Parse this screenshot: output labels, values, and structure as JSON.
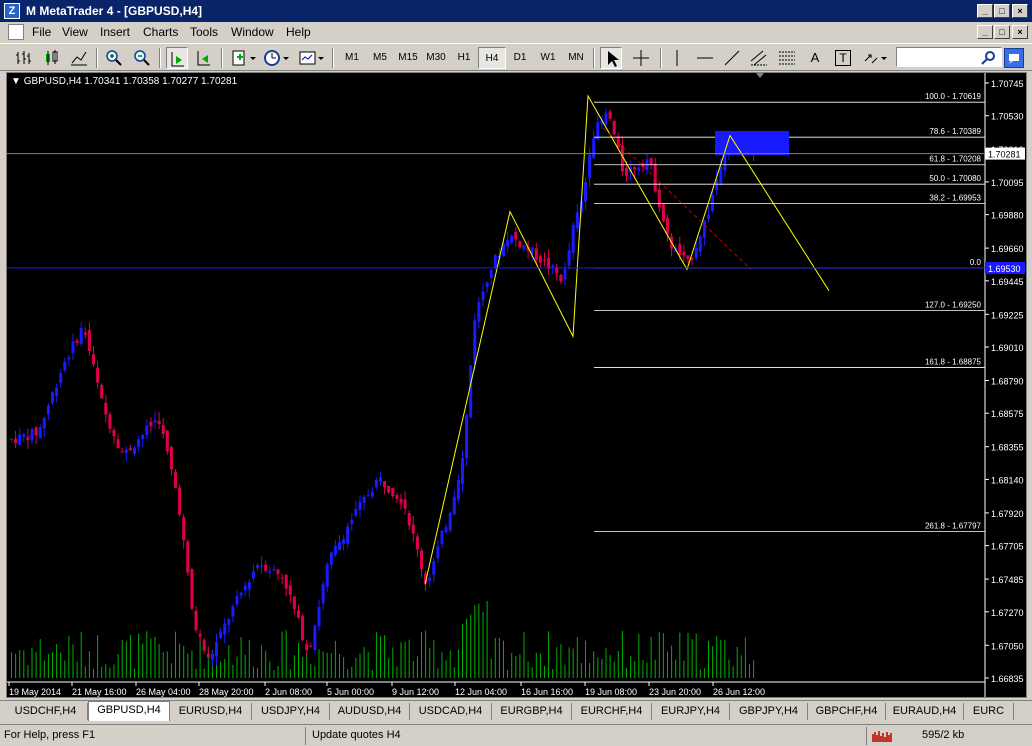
{
  "window": {
    "title": "M MetaTrader 4 - [GBPUSD,H4]",
    "controls": [
      "_",
      "□",
      "×"
    ]
  },
  "menu": [
    "File",
    "View",
    "Insert",
    "Charts",
    "Tools",
    "Window",
    "Help"
  ],
  "toolbar": {
    "timeframes": [
      "M1",
      "M5",
      "M15",
      "M30",
      "H1",
      "H4",
      "D1",
      "W1",
      "MN"
    ],
    "active_timeframe": "H4",
    "tools": [
      "A",
      "T"
    ]
  },
  "chart": {
    "info": "GBPUSD,H4  1.70341 1.70358 1.70277 1.70281",
    "price_labels": [
      "1.70745",
      "1.70530",
      "1.70310",
      "1.70095",
      "1.69880",
      "1.69660",
      "1.69445",
      "1.69225",
      "1.69010",
      "1.68790",
      "1.68575",
      "1.68355",
      "1.68140",
      "1.67920",
      "1.67705",
      "1.67485",
      "1.67270",
      "1.67050",
      "1.66835"
    ],
    "current_price": "1.70281",
    "blue_level": "1.69530",
    "time_labels": [
      "19 May 2014",
      "21 May 16:00",
      "26 May 04:00",
      "28 May 20:00",
      "2 Jun 08:00",
      "5 Jun 00:00",
      "9 Jun 12:00",
      "12 Jun 04:00",
      "16 Jun 16:00",
      "19 Jun 08:00",
      "23 Jun 20:00",
      "26 Jun 12:00"
    ],
    "fib_levels": [
      {
        "label": "100.0 - 1.70619",
        "price": 1.70619
      },
      {
        "label": "78.6 - 1.70389",
        "price": 1.70389
      },
      {
        "label": "61.8 - 1.70208",
        "price": 1.70208
      },
      {
        "label": "50.0 - 1.70080",
        "price": 1.7008
      },
      {
        "label": "38.2 - 1.69953",
        "price": 1.69953
      },
      {
        "label": "0.0",
        "price": 1.6953
      },
      {
        "label": "127.0 - 1.69250",
        "price": 1.6925
      },
      {
        "label": "161.8 - 1.68875",
        "price": 1.68875
      },
      {
        "label": "261.8 - 1.67797",
        "price": 1.67797
      }
    ]
  },
  "tabs": [
    "USDCHF,H4",
    "GBPUSD,H4",
    "EURUSD,H4",
    "USDJPY,H4",
    "AUDUSD,H4",
    "USDCAD,H4",
    "EURGBP,H4",
    "EURCHF,H4",
    "EURJPY,H4",
    "GBPJPY,H4",
    "GBPCHF,H4",
    "EURAUD,H4",
    "EURC"
  ],
  "active_tab": "GBPUSD,H4",
  "status": {
    "help": "For Help, press F1",
    "update": "Update quotes H4",
    "traffic": "595/2 kb"
  }
}
